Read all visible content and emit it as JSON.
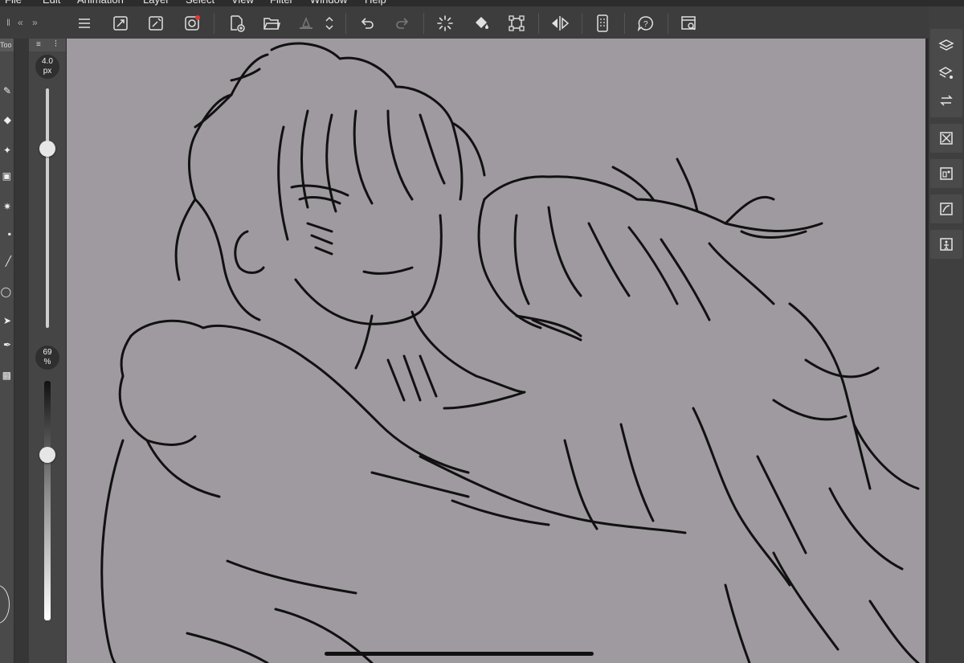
{
  "menubar": {
    "items": [
      "File",
      "Edit",
      "Animation",
      "Layer",
      "Select",
      "View",
      "Filter",
      "Window",
      "Help"
    ]
  },
  "command_bar": {
    "icons": [
      "menu-icon",
      "fit-canvas-icon",
      "rotate-canvas-icon",
      "quick-access-icon",
      "new-file-icon",
      "open-file-icon",
      "save-icon",
      "undo-icon",
      "redo-icon",
      "clear-icon",
      "fill-icon",
      "transform-icon",
      "flip-horizontal-icon",
      "smartphone-connect-icon",
      "help-icon",
      "assist-window-icon"
    ]
  },
  "left_toolbar": {
    "tab_label": "Too"
  },
  "brush_size": {
    "value": "4.0",
    "unit": "px",
    "level": 0.25
  },
  "brush_opacity": {
    "value": "69",
    "unit": "%",
    "level": 0.31
  },
  "right_panel": {
    "icons": [
      "layers-icon",
      "layer-properties-icon",
      "navigator-icon",
      "material-icon",
      "sub-tool-detail-icon",
      "file-object-icon",
      "animation-timeline-icon"
    ]
  },
  "colors": {
    "canvas": "#9f9aa0",
    "panel": "#3d3d3d",
    "sketch_stroke": "#111111"
  }
}
